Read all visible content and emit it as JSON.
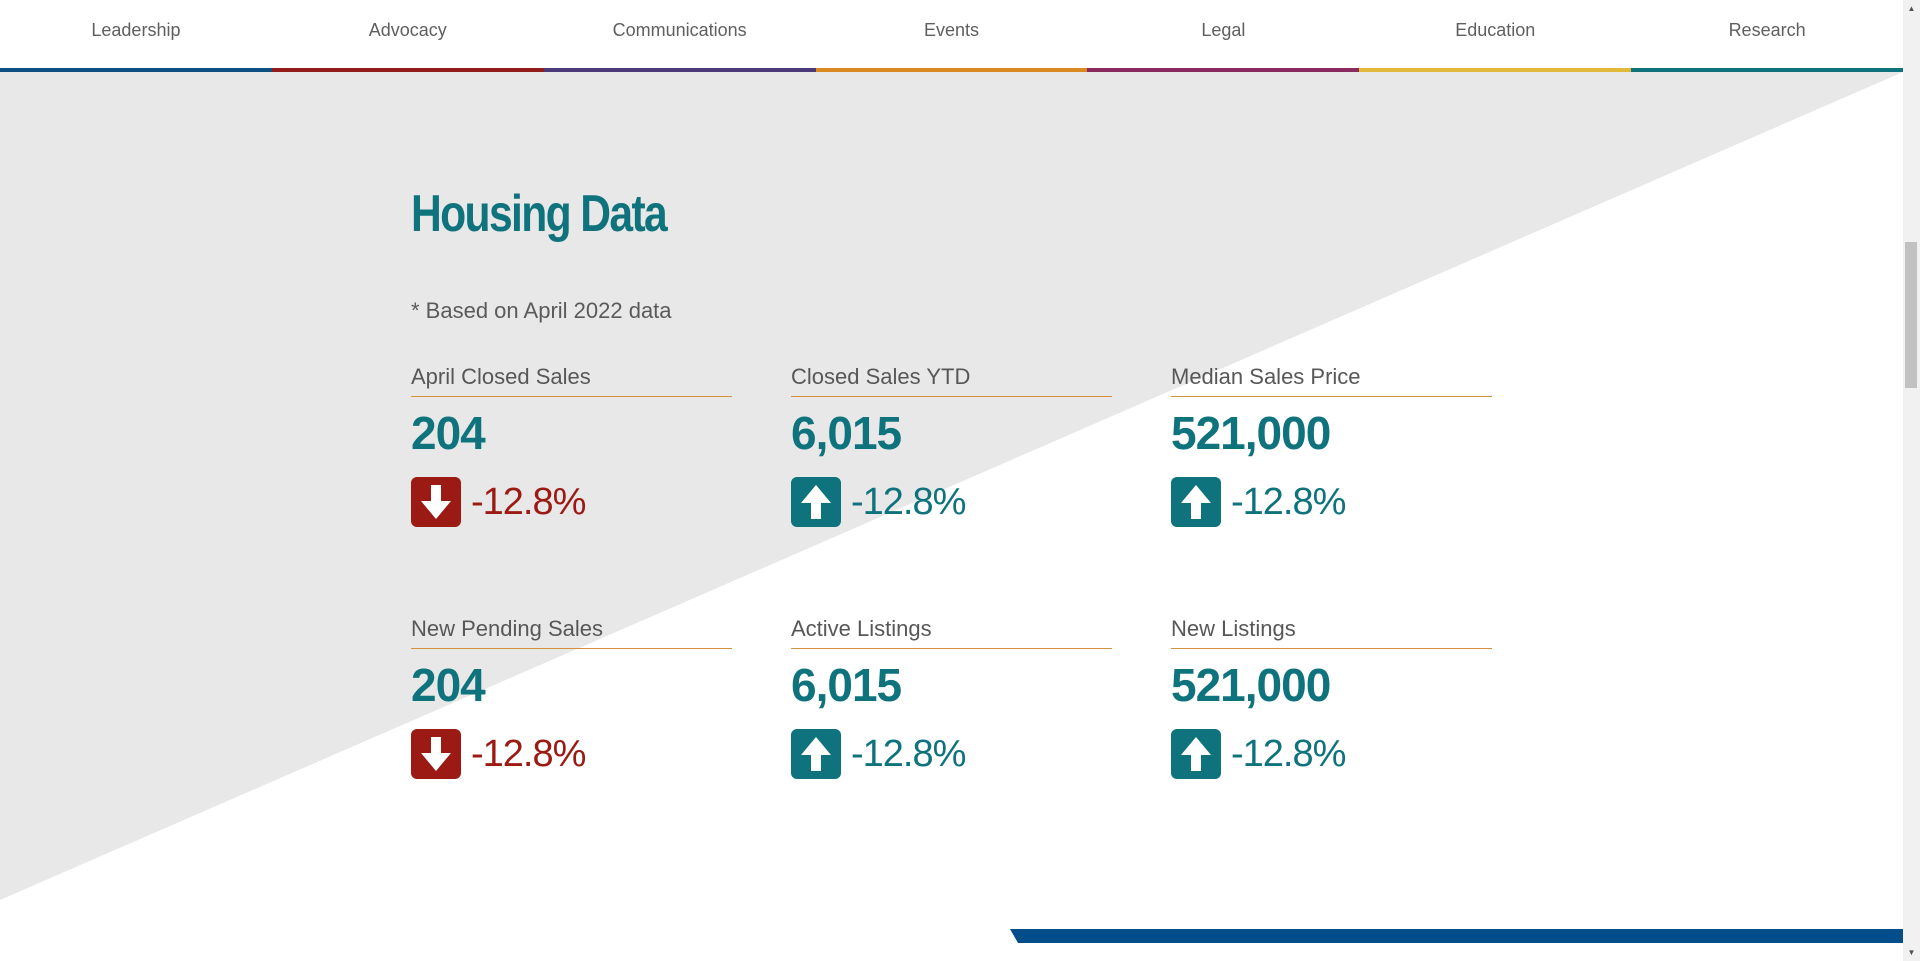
{
  "nav": {
    "items": [
      {
        "label": "Leadership",
        "color": "#0c4f80"
      },
      {
        "label": "Advocacy",
        "color": "#931c1a"
      },
      {
        "label": "Communications",
        "color": "#4a3a78"
      },
      {
        "label": "Events",
        "color": "#db8a21"
      },
      {
        "label": "Legal",
        "color": "#8a2a5e"
      },
      {
        "label": "Education",
        "color": "#e3b93b"
      },
      {
        "label": "Research",
        "color": "#0f737d"
      }
    ]
  },
  "section": {
    "title": "Housing Data",
    "subtitle": "* Based on April 2022 data"
  },
  "colors": {
    "accent": "#0f737d",
    "down": "#9b1b14",
    "rule": "#d4913e",
    "background_triangle": "#e8e8e8",
    "bottom_bar": "#034e8a"
  },
  "stats": [
    {
      "label": "April Closed Sales",
      "value": "204",
      "change": "-12.8%",
      "direction": "down"
    },
    {
      "label": "Closed Sales YTD",
      "value": "6,015",
      "change": "-12.8%",
      "direction": "up"
    },
    {
      "label": "Median Sales Price",
      "value": "521,000",
      "change": "-12.8%",
      "direction": "up"
    },
    {
      "label": "New Pending Sales",
      "value": "204",
      "change": "-12.8%",
      "direction": "down"
    },
    {
      "label": "Active Listings",
      "value": "6,015",
      "change": "-12.8%",
      "direction": "up"
    },
    {
      "label": "New Listings",
      "value": "521,000",
      "change": "-12.8%",
      "direction": "up"
    }
  ],
  "icons": {
    "down": "arrow-down-icon",
    "up": "arrow-up-icon"
  }
}
